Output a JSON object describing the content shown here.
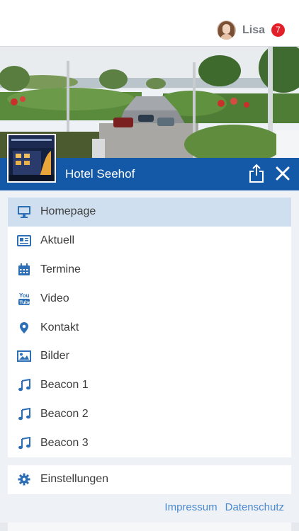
{
  "user": {
    "name": "Lisa",
    "notifications": "7"
  },
  "hotel": {
    "name": "Hotel Seehof"
  },
  "menu": {
    "items": [
      {
        "label": "Homepage",
        "icon": "monitor-icon",
        "active": true
      },
      {
        "label": "Aktuell",
        "icon": "newspaper-icon",
        "active": false
      },
      {
        "label": "Termine",
        "icon": "calendar-icon",
        "active": false
      },
      {
        "label": "Video",
        "icon": "youtube-icon",
        "active": false
      },
      {
        "label": "Kontakt",
        "icon": "map-pin-icon",
        "active": false
      },
      {
        "label": "Bilder",
        "icon": "image-icon",
        "active": false
      },
      {
        "label": "Beacon 1",
        "icon": "music-note-icon",
        "active": false
      },
      {
        "label": "Beacon 2",
        "icon": "music-note-icon",
        "active": false
      },
      {
        "label": "Beacon 3",
        "icon": "music-note-icon",
        "active": false
      }
    ]
  },
  "settings": {
    "label": "Einstellungen",
    "icon": "gear-icon"
  },
  "footer": {
    "impressum": "Impressum",
    "datenschutz": "Datenschutz"
  },
  "colors": {
    "brand": "#1458a8",
    "icon": "#2c6fb6",
    "active_bg": "#cfdfef",
    "badge": "#e3202a",
    "link": "#4a8ad0"
  }
}
